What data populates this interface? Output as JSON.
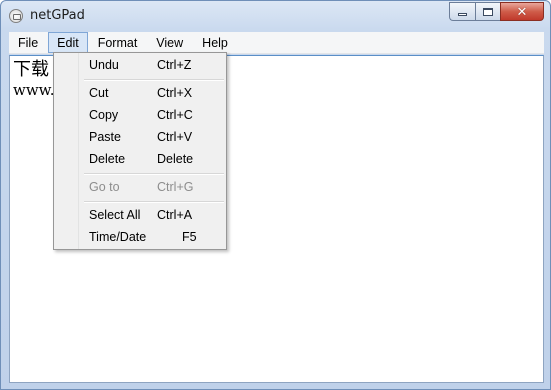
{
  "window": {
    "title": "netGPad"
  },
  "menubar": {
    "items": [
      "File",
      "Edit",
      "Format",
      "View",
      "Help"
    ],
    "active": "Edit"
  },
  "editor": {
    "line1": "下载",
    "line2": "www."
  },
  "edit_menu": {
    "items": [
      {
        "label": "Undu",
        "shortcut": "Ctrl+Z",
        "enabled": true
      },
      {
        "label": "Cut",
        "shortcut": "Ctrl+X",
        "enabled": true
      },
      {
        "label": "Copy",
        "shortcut": "Ctrl+C",
        "enabled": true
      },
      {
        "label": "Paste",
        "shortcut": "Ctrl+V",
        "enabled": true
      },
      {
        "label": "Delete",
        "shortcut": "Delete",
        "enabled": true
      },
      {
        "label": "Go to",
        "shortcut": "Ctrl+G",
        "enabled": false
      },
      {
        "label": "Select All",
        "shortcut": "Ctrl+A",
        "enabled": true
      },
      {
        "label": "Time/Date",
        "shortcut": "F5",
        "enabled": true
      }
    ]
  },
  "icons": {
    "app": "notepad-icon",
    "minimize": "minimize-icon",
    "maximize": "maximize-icon",
    "close": "close-icon"
  },
  "colors": {
    "menu_highlight": "#d8e6f7",
    "close_button": "#c0392b",
    "disabled_text": "#8d8d8d"
  }
}
